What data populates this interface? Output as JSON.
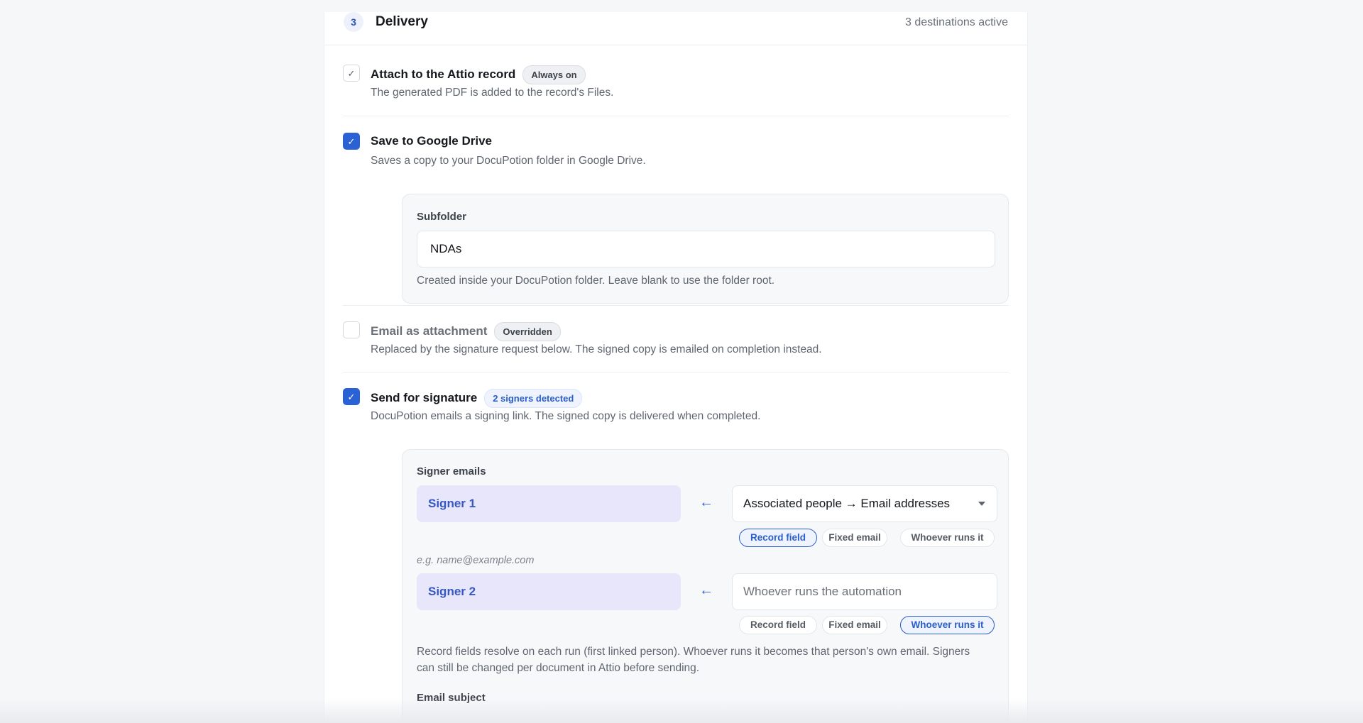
{
  "header": {
    "step_number": "3",
    "title": "Delivery",
    "meta": "3 destinations active"
  },
  "attach": {
    "checked": true,
    "title": "Attach to the Attio record",
    "badge": "Always on",
    "description": "The generated PDF is added to the record's Files."
  },
  "drive": {
    "checked": true,
    "title": "Save to Google Drive",
    "description": "Saves a copy to your DocuPotion folder in Google Drive.",
    "subfolder_label": "Subfolder",
    "subfolder_value": "NDAs",
    "subfolder_help": "Created inside your DocuPotion folder. Leave blank to use the folder root."
  },
  "email": {
    "checked": false,
    "title": "Email as attachment",
    "badge": "Overridden",
    "description": "Replaced by the signature request below. The signed copy is emailed on completion instead."
  },
  "signature": {
    "checked": true,
    "title": "Send for signature",
    "badge": "2 signers detected",
    "description": "DocuPotion emails a signing link. The signed copy is delivered when completed.",
    "signer_emails_label": "Signer emails",
    "signers": [
      {
        "name": "Signer 1",
        "source_value": "Associated people → Email addresses",
        "source_is_placeholder": false,
        "modes": [
          "Record field",
          "Fixed email",
          "Whoever runs it"
        ],
        "active_mode": "Record field"
      },
      {
        "name": "Signer 2",
        "source_value": "Whoever runs the automation",
        "source_is_placeholder": true,
        "modes": [
          "Record field",
          "Fixed email",
          "Whoever runs it"
        ],
        "active_mode": "Whoever runs it"
      }
    ],
    "example_email": "e.g. name@example.com",
    "help_line1": "Record fields resolve on each run (first linked person). Whoever runs it becomes that person's own email. Signers",
    "help_line2": "can still be changed per document in Attio before sending.",
    "email_subject_label": "Email subject"
  },
  "icons": {
    "check": "check-icon",
    "arrow": "arrow-left-icon",
    "caret": "chevron-down-icon"
  },
  "colors": {
    "accent": "#2a62d6",
    "signer_chip_bg": "#e8e6fa",
    "panel_bg": "#f7f8fa"
  }
}
